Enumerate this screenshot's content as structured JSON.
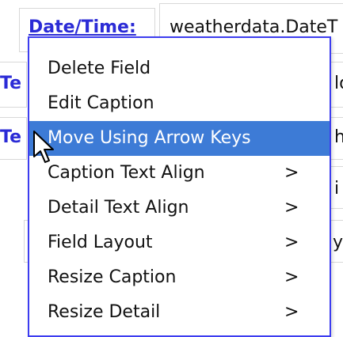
{
  "form": {
    "date_caption": "Date/Time:",
    "date_value": "weatherdata.DateT",
    "fragments": {
      "row2_left": "Te",
      "row2_right": "lo",
      "row3_left": "Te",
      "row3_right": "h'",
      "row4_right": "i",
      "row5_right": "yF"
    }
  },
  "context_menu": {
    "items": [
      {
        "label": "Delete Field",
        "has_submenu": false,
        "submenu_marker": ""
      },
      {
        "label": "Edit Caption",
        "has_submenu": false,
        "submenu_marker": ""
      },
      {
        "label": "Move Using Arrow Keys",
        "has_submenu": false,
        "submenu_marker": "",
        "highlighted": true
      },
      {
        "label": "Caption Text Align",
        "has_submenu": true,
        "submenu_marker": ">"
      },
      {
        "label": "Detail Text Align",
        "has_submenu": true,
        "submenu_marker": ">"
      },
      {
        "label": "Field Layout",
        "has_submenu": true,
        "submenu_marker": ">"
      },
      {
        "label": "Resize Caption",
        "has_submenu": true,
        "submenu_marker": ">"
      },
      {
        "label": "Resize Detail",
        "has_submenu": true,
        "submenu_marker": ">"
      }
    ]
  },
  "colors": {
    "highlight": "#3d7bd6",
    "menu_border": "#3d3df0",
    "caption_blue": "#2b2bd6"
  },
  "icons": {
    "cursor": "arrow-pointer-icon"
  }
}
